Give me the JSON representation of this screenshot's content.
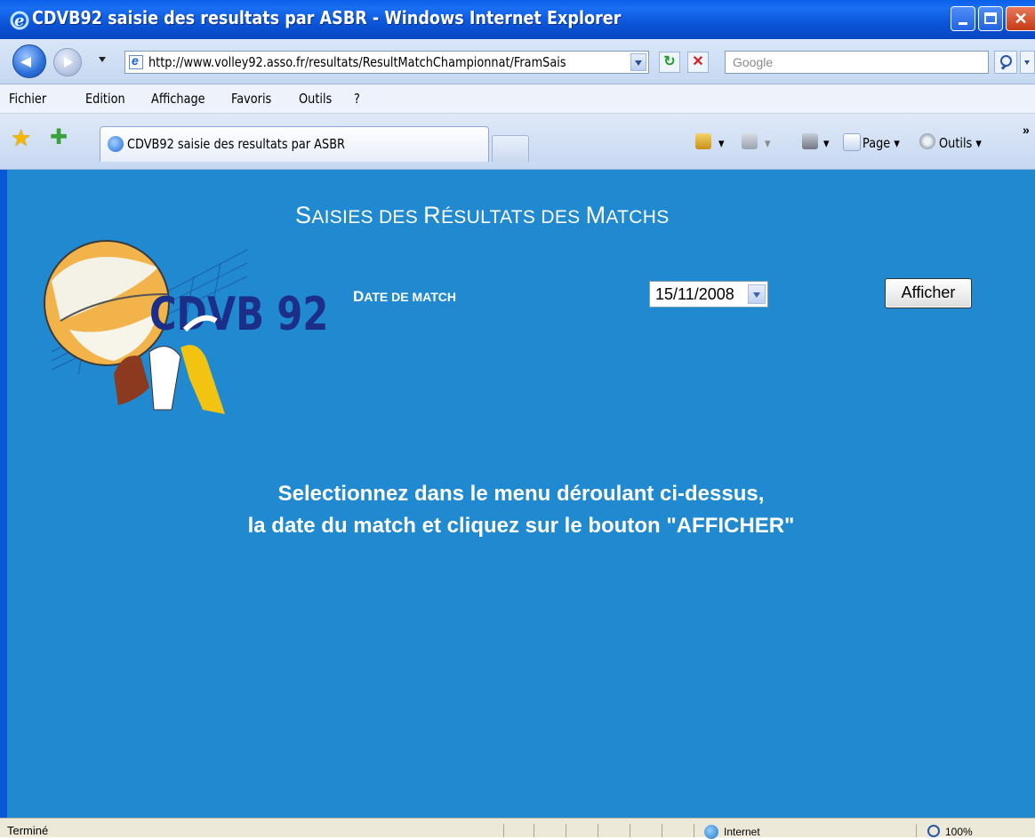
{
  "window": {
    "title": "CDVB92 saisie des resultats par ASBR - Windows Internet Explorer"
  },
  "address_bar": {
    "url": "http://www.volley92.asso.fr/resultats/ResultMatchChampionnat/FramSais",
    "search_placeholder": "Google"
  },
  "menu": {
    "items": [
      "Fichier",
      "Edition",
      "Affichage",
      "Favoris",
      "Outils",
      "?"
    ]
  },
  "tab": {
    "label": "CDVB92 saisie des resultats par ASBR"
  },
  "commands": {
    "page": "Page",
    "tools": "Outils",
    "more": "»"
  },
  "page": {
    "title_caps": [
      "S",
      "AISIES DES ",
      "R",
      "ÉSULTATS DES ",
      "M",
      "ATCHS"
    ],
    "logo_text": "CDVB 92",
    "date_label_first": "D",
    "date_label_rest": "ATE DE MATCH",
    "date_value": "15/11/2008",
    "afficher_label": "Afficher",
    "instruction_line1": "Selectionnez dans le menu déroulant ci-dessus,",
    "instruction_line2": "la date du match et cliquez sur le bouton \"AFFICHER\""
  },
  "status": {
    "left_text": "Terminé",
    "zone_text": "Internet",
    "zoom": "100%"
  },
  "colors": {
    "page_background": "#2089d0",
    "titlebar": "#0a55d8",
    "text_on_page": "#ffffff"
  }
}
